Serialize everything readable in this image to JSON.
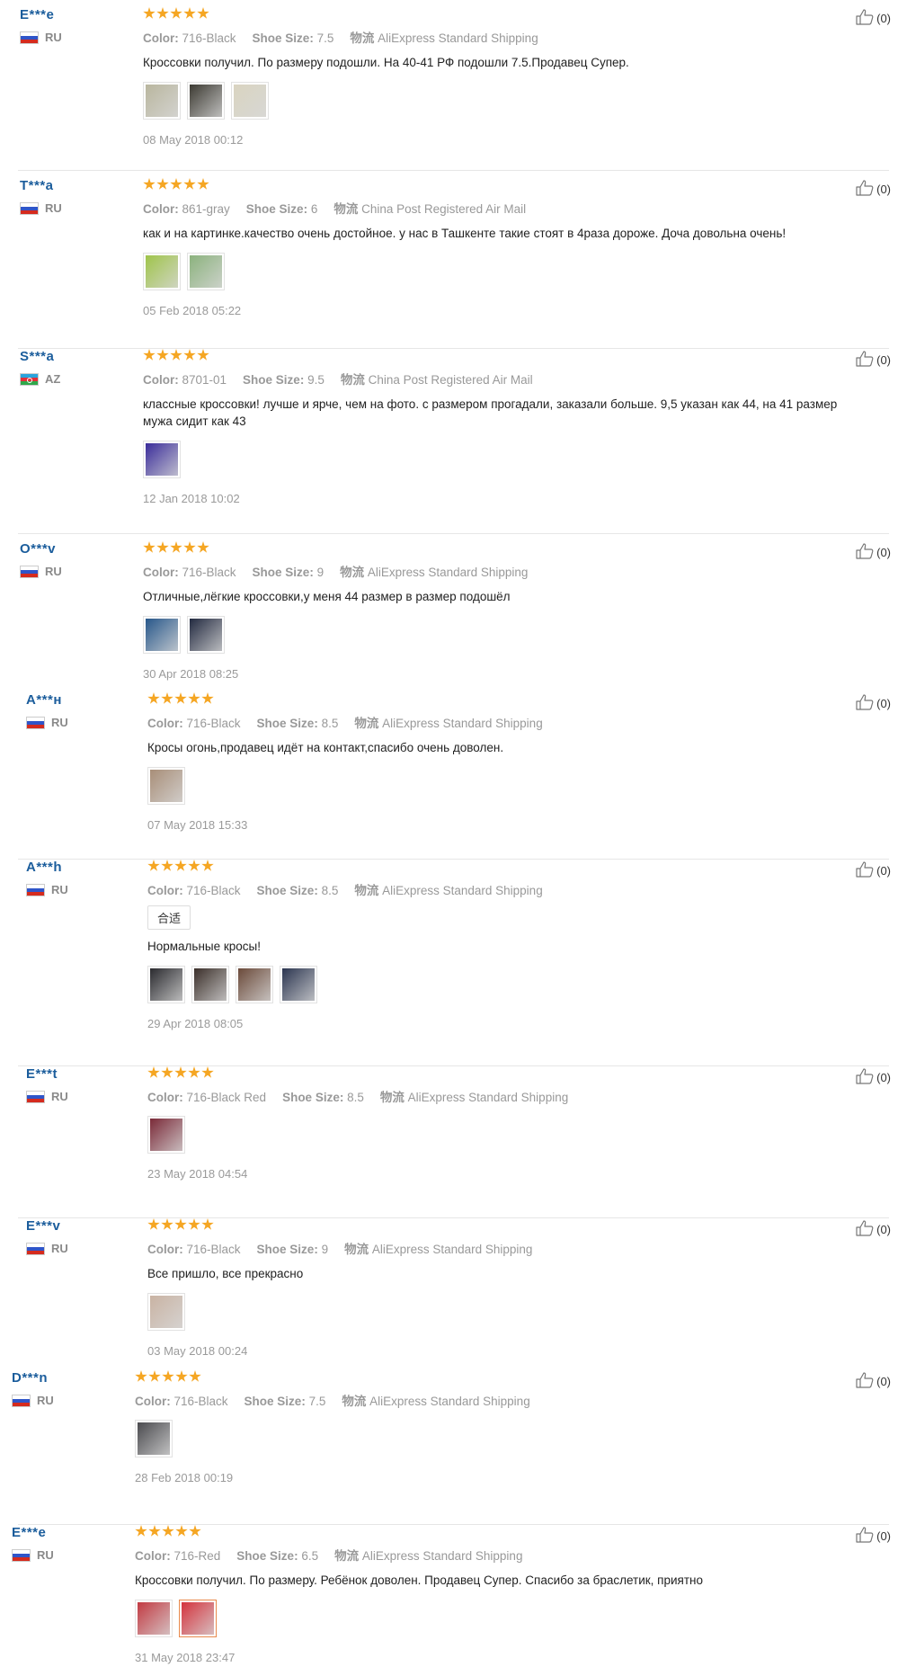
{
  "reviews": [
    {
      "user": "E***e",
      "country": "RU",
      "flag": "ru",
      "color": "716-Black",
      "size": "7.5",
      "shipping": "AliExpress Standard Shipping",
      "text": "Кроссовки получил. По размеру подошли. На 40-41 РФ подошли 7.5.Продавец Супер.",
      "photos": [
        "#b9b69e",
        "#3c3a32",
        "#d9d4c0"
      ],
      "date": "08 May 2018 00:12",
      "likes": "(0)"
    },
    {
      "user": "T***a",
      "country": "RU",
      "flag": "ru",
      "color": "861-gray",
      "size": "6",
      "shipping": "China Post Registered Air Mail",
      "text": "как и на картинке.качество очень достойное. у нас в Ташкенте такие стоят в 4раза дороже. Доча довольна очень!",
      "photos": [
        "#9fc44a",
        "#8bb27d"
      ],
      "date": "05 Feb 2018 05:22",
      "likes": "(0)"
    },
    {
      "user": "S***a",
      "country": "AZ",
      "flag": "az",
      "color": "8701-01",
      "size": "9.5",
      "shipping": "China Post Registered Air Mail",
      "text": "классные кроссовки! лучше и ярче, чем на фото. с размером прогадали, заказали больше. 9,5 указан как 44, на 41 размер мужа сидит как 43",
      "photos": [
        "#3a2c9a"
      ],
      "date": "12 Jan 2018 10:02",
      "likes": "(0)"
    },
    {
      "user": "O***v",
      "country": "RU",
      "flag": "ru",
      "color": "716-Black",
      "size": "9",
      "shipping": "AliExpress Standard Shipping",
      "text": "Отличные,лёгкие кроссовки,у меня 44 размер в размер подошёл",
      "photos": [
        "#27578a",
        "#222a40"
      ],
      "date": "30 Apr 2018 08:25",
      "likes": "(0)"
    },
    {
      "user": "A***н",
      "country": "RU",
      "flag": "ru",
      "color": "716-Black",
      "size": "8.5",
      "shipping": "AliExpress Standard Shipping",
      "text": "Кросы огонь,продавец идёт на контакт,спасибо очень доволен.",
      "photos": [
        "#a88e78"
      ],
      "date": "07 May 2018 15:33",
      "likes": "(0)"
    },
    {
      "user": "A***h",
      "country": "RU",
      "flag": "ru",
      "color": "716-Black",
      "size": "8.5",
      "shipping": "AliExpress Standard Shipping",
      "tag": "合适",
      "text": "Нормальные кросы!",
      "photos": [
        "#2a2a2e",
        "#3b2f2a",
        "#6b4a3a",
        "#2b3550"
      ],
      "date": "29 Apr 2018 08:05",
      "likes": "(0)"
    },
    {
      "user": "E***t",
      "country": "RU",
      "flag": "ru",
      "color": "716-Black Red",
      "size": "8.5",
      "shipping": "AliExpress Standard Shipping",
      "text": "",
      "photos": [
        "#7a2a38"
      ],
      "date": "23 May 2018 04:54",
      "likes": "(0)"
    },
    {
      "user": "E***v",
      "country": "RU",
      "flag": "ru",
      "color": "716-Black",
      "size": "9",
      "shipping": "AliExpress Standard Shipping",
      "text": "Все пришло, все прекрасно",
      "photos": [
        "#c9b3a3"
      ],
      "date": "03 May 2018 00:24",
      "likes": "(0)"
    },
    {
      "user": "D***n",
      "country": "RU",
      "flag": "ru",
      "color": "716-Black",
      "size": "7.5",
      "shipping": "AliExpress Standard Shipping",
      "text": "",
      "photos": [
        "#4a4a4e"
      ],
      "date": "28 Feb 2018 00:19",
      "likes": "(0)"
    },
    {
      "user": "E***e",
      "country": "RU",
      "flag": "ru",
      "color": "716-Red",
      "size": "6.5",
      "shipping": "AliExpress Standard Shipping",
      "text": "Кроссовки получил. По размеру. Ребёнок доволен. Продавец Супер. Спасибо за браслетик, приятно",
      "photos": [
        "#c23a42",
        "#d4343e"
      ],
      "date": "31 May 2018 23:47",
      "likes": "(0)"
    }
  ],
  "labels": {
    "color": "Color:",
    "size": "Shoe Size:",
    "ship_prefix": "物流"
  }
}
